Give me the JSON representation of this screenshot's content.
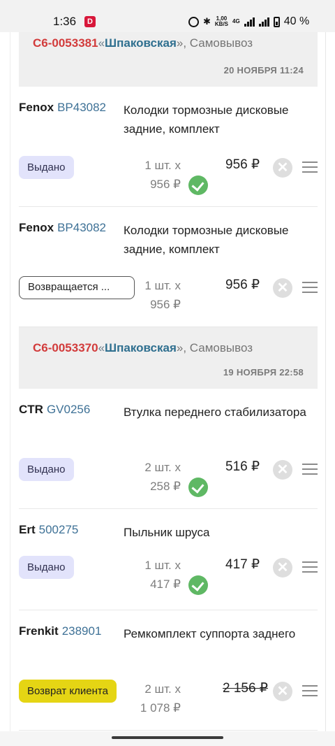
{
  "status_bar": {
    "time": "1:36",
    "app_badge": "D",
    "bt": "✱",
    "speed_value": "1,00",
    "speed_unit": "KB/S",
    "network": "4G",
    "battery": "40 %"
  },
  "orders": [
    {
      "id": "С6-0053381",
      "open_quote": "«",
      "store": "Шпаковская",
      "close_quote": "», Самовывоз",
      "date": "20 НОЯБРЯ 11:24",
      "items": [
        {
          "brand": "Fenox",
          "code": "BP43082",
          "name": "Колодки тормозные дисковые задние, комплект",
          "status": "Выдано",
          "status_type": "issued",
          "qty": "1 шт. х",
          "unit_price": "956 ₽",
          "total": "956 ₽",
          "checked": true,
          "struck": false
        },
        {
          "brand": "Fenox",
          "code": "BP43082",
          "name": "Колодки тормозные дисковые задние, комплект",
          "status": "Возвращается ...",
          "status_type": "returning",
          "qty": "1 шт. х",
          "unit_price": "956 ₽",
          "total": "956 ₽",
          "checked": false,
          "struck": false
        }
      ]
    },
    {
      "id": "С6-0053370",
      "open_quote": "«",
      "store": "Шпаковская",
      "close_quote": "», Самовывоз",
      "date": "19 НОЯБРЯ 22:58",
      "items": [
        {
          "brand": "CTR",
          "code": "GV0256",
          "name": "Втулка переднего стабилизатора",
          "status": "Выдано",
          "status_type": "issued",
          "qty": "2 шт. х",
          "unit_price": "258 ₽",
          "total": "516 ₽",
          "checked": true,
          "struck": false
        },
        {
          "brand": "Ert",
          "code": "500275",
          "name": "Пыльник шруса",
          "status": "Выдано",
          "status_type": "issued",
          "qty": "1 шт. х",
          "unit_price": "417 ₽",
          "total": "417 ₽",
          "checked": true,
          "struck": false
        },
        {
          "brand": "Frenkit",
          "code": "238901",
          "name": "Ремкомплект суппорта заднего",
          "status": "Возврат клиента",
          "status_type": "client",
          "qty": "2 шт. х",
          "unit_price": "1 078 ₽",
          "total": "2 156 ₽",
          "checked": false,
          "struck": true
        }
      ]
    }
  ],
  "icons": {
    "cancel": "close-circle-icon",
    "menu": "drag-handle-icon",
    "check": "check-circle-icon"
  },
  "colors": {
    "order_id": "#d23b3b",
    "store": "#2f6f8f",
    "issued_badge": "#e2e3fb",
    "client_return_badge": "#e5d514",
    "check": "#5fb864"
  }
}
